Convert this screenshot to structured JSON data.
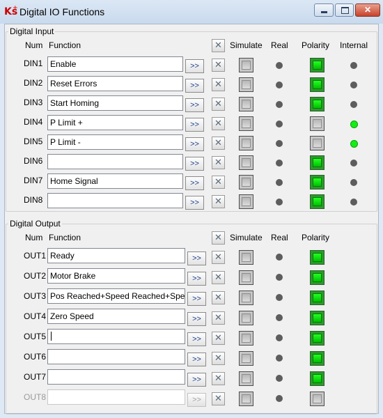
{
  "window": {
    "title": "Digital IO Functions",
    "app_icon_text": "Ks"
  },
  "input": {
    "group_title": "Digital Input",
    "headers": {
      "num": "Num",
      "function": "Function",
      "simulate": "Simulate",
      "real": "Real",
      "polarity": "Polarity",
      "internal": "Internal"
    },
    "rows": [
      {
        "label": "DIN1",
        "function": "Enable",
        "polarity_on": true,
        "internal_on": false
      },
      {
        "label": "DIN2",
        "function": "Reset Errors",
        "polarity_on": true,
        "internal_on": false
      },
      {
        "label": "DIN3",
        "function": "Start Homing",
        "polarity_on": true,
        "internal_on": false
      },
      {
        "label": "DIN4",
        "function": "P Limit +",
        "polarity_on": false,
        "internal_on": true
      },
      {
        "label": "DIN5",
        "function": "P Limit -",
        "polarity_on": false,
        "internal_on": true
      },
      {
        "label": "DIN6",
        "function": "",
        "polarity_on": true,
        "internal_on": false
      },
      {
        "label": "DIN7",
        "function": "Home Signal",
        "polarity_on": true,
        "internal_on": false
      },
      {
        "label": "DIN8",
        "function": "",
        "polarity_on": true,
        "internal_on": false
      }
    ]
  },
  "output": {
    "group_title": "Digital Output",
    "headers": {
      "num": "Num",
      "function": "Function",
      "simulate": "Simulate",
      "real": "Real",
      "polarity": "Polarity"
    },
    "rows": [
      {
        "label": "OUT1",
        "function": "Ready",
        "polarity_on": true,
        "disabled": false
      },
      {
        "label": "OUT2",
        "function": "Motor Brake",
        "polarity_on": true,
        "disabled": false
      },
      {
        "label": "OUT3",
        "function": "Pos Reached+Speed Reached+Spee",
        "polarity_on": true,
        "disabled": false
      },
      {
        "label": "OUT4",
        "function": "Zero Speed",
        "polarity_on": true,
        "disabled": false
      },
      {
        "label": "OUT5",
        "function": "",
        "polarity_on": true,
        "disabled": false
      },
      {
        "label": "OUT6",
        "function": "",
        "polarity_on": true,
        "disabled": false
      },
      {
        "label": "OUT7",
        "function": "",
        "polarity_on": true,
        "disabled": false
      },
      {
        "label": "OUT8",
        "function": "",
        "polarity_on": false,
        "disabled": true
      }
    ]
  },
  "buttons": {
    "assign_label": ">>",
    "clear_icon": "clear-x-icon"
  },
  "colors": {
    "led_off": "#5d5d5d",
    "led_on": "#12f012",
    "polarity_on": "#00d000",
    "close_button": "#c7422c"
  }
}
